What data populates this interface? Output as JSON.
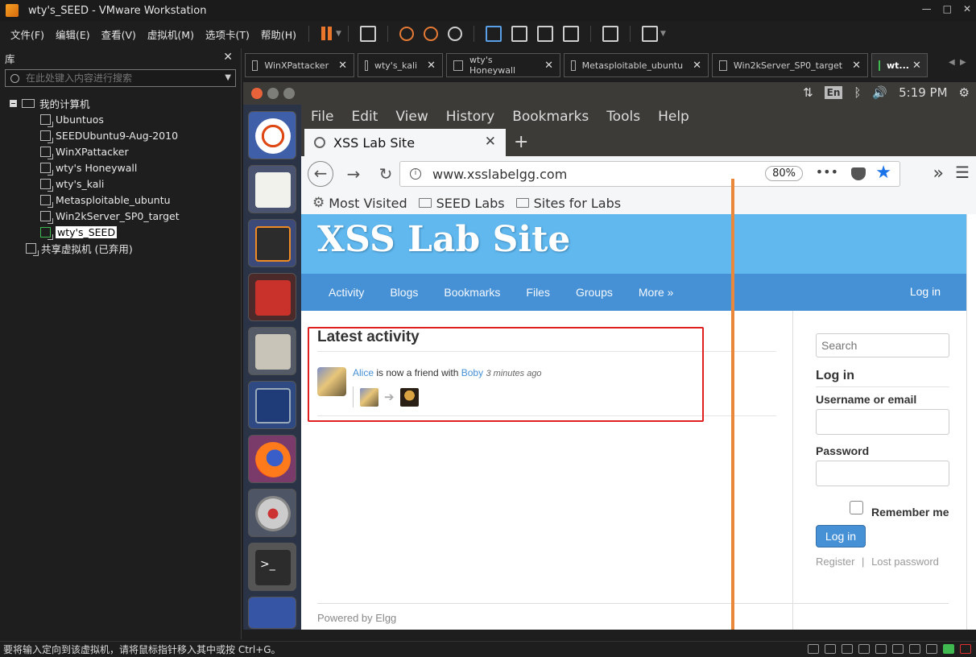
{
  "window": {
    "title": "wty's_SEED - VMware Workstation",
    "controls": [
      "—",
      "□",
      "✕"
    ]
  },
  "menubar": {
    "items": [
      "文件(F)",
      "编辑(E)",
      "查看(V)",
      "虚拟机(M)",
      "选项卡(T)",
      "帮助(H)"
    ]
  },
  "library": {
    "title": "库",
    "search_placeholder": "在此处键入内容进行搜索",
    "root": "我的计算机",
    "vms": [
      "Ubuntuos",
      "SEEDUbuntu9-Aug-2010",
      "WinXPattacker",
      "wty's Honeywall",
      "wty's_kali",
      "Metasploitable_ubuntu",
      "Win2kServer_SP0_target",
      "wty's_SEED"
    ],
    "shared": "共享虚拟机 (已弃用)"
  },
  "vm_tabs": [
    "WinXPattacker",
    "wty's_kali",
    "wty's Honeywall",
    "Metasploitable_ubuntu",
    "Win2kServer_SP0_target",
    "wt..."
  ],
  "ubuntu_panel": {
    "lang": "En",
    "time": "5:19 PM"
  },
  "firefox": {
    "menu": [
      "File",
      "Edit",
      "View",
      "History",
      "Bookmarks",
      "Tools",
      "Help"
    ],
    "tab_title": "XSS Lab Site",
    "url": "www.xsslabelgg.com",
    "zoom": "80%",
    "bookmarks": [
      "Most Visited",
      "SEED Labs",
      "Sites for Labs"
    ]
  },
  "site": {
    "title": "XSS Lab Site",
    "nav": [
      "Activity",
      "Blogs",
      "Bookmarks",
      "Files",
      "Groups",
      "More »"
    ],
    "login_link": "Log in",
    "latest_activity": "Latest activity",
    "river": {
      "subject": "Alice",
      "verb": "is now a friend with",
      "object": "Boby",
      "time": "3 minutes ago"
    },
    "sidebar": {
      "search_placeholder": "Search",
      "login_heading": "Log in",
      "username_label": "Username or email",
      "password_label": "Password",
      "remember": "Remember me",
      "login_button": "Log in",
      "register": "Register",
      "sep": "|",
      "lost_password": "Lost password"
    },
    "footer": "Powered by Elgg"
  },
  "statusbar": {
    "message": "要将输入定向到该虚拟机，请将鼠标指针移入其中或按 Ctrl+G。"
  }
}
